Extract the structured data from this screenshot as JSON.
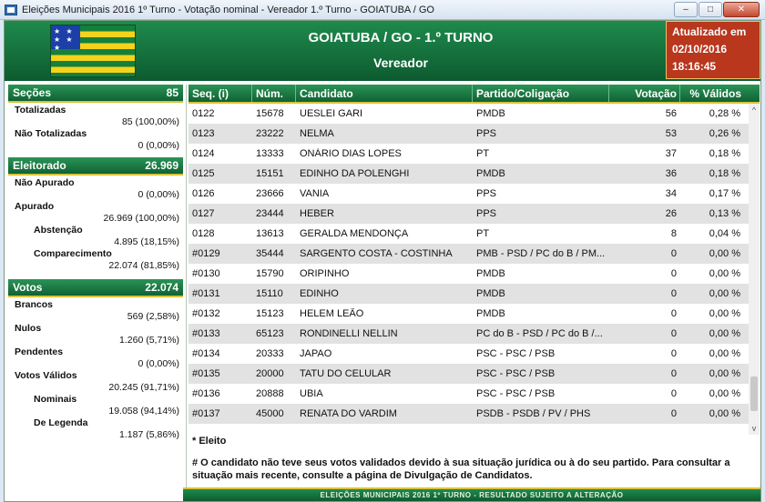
{
  "window": {
    "title": "Eleições Municipais 2016 1º Turno - Votação nominal - Vereador 1.º Turno - GOIATUBA / GO",
    "minimize": "–",
    "maximize": "□",
    "close": "✕"
  },
  "header": {
    "title": "GOIATUBA / GO - 1.º TURNO",
    "subtitle": "Vereador",
    "flag_stars": "★ ★ ★ ★ ★",
    "updated_label": "Atualizado em",
    "updated_date": "02/10/2016",
    "updated_time": "18:16:45"
  },
  "sidebar": {
    "secoes": {
      "label": "Seções",
      "value": "85"
    },
    "totalizadas": {
      "label": "Totalizadas",
      "value": "85 (100,00%)"
    },
    "nao_totalizadas": {
      "label": "Não Totalizadas",
      "value": "0 (0,00%)"
    },
    "eleitorado": {
      "label": "Eleitorado",
      "value": "26.969"
    },
    "nao_apurado": {
      "label": "Não Apurado",
      "value": "0 (0,00%)"
    },
    "apurado": {
      "label": "Apurado",
      "value": "26.969 (100,00%)"
    },
    "abstencao": {
      "label": "Abstenção",
      "value": "4.895 (18,15%)"
    },
    "comparecimento": {
      "label": "Comparecimento",
      "value": "22.074 (81,85%)"
    },
    "votos": {
      "label": "Votos",
      "value": "22.074"
    },
    "brancos": {
      "label": "Brancos",
      "value": "569 (2,58%)"
    },
    "nulos": {
      "label": "Nulos",
      "value": "1.260 (5,71%)"
    },
    "pendentes": {
      "label": "Pendentes",
      "value": "0 (0,00%)"
    },
    "votos_validos": {
      "label": "Votos Válidos",
      "value": "20.245 (91,71%)"
    },
    "nominais": {
      "label": "Nominais",
      "value": "19.058 (94,14%)"
    },
    "legenda": {
      "label": "De Legenda",
      "value": "1.187 (5,86%)"
    }
  },
  "table": {
    "headers": [
      "Seq.  (i)",
      "Núm.",
      "Candidato",
      "Partido/Coligação",
      "Votação",
      "% Válidos"
    ],
    "rows": [
      {
        "seq": "0122",
        "num": "15678",
        "cand": "UESLEI GARI",
        "party": "PMDB",
        "votes": "56",
        "pct": "0,28 %"
      },
      {
        "seq": "0123",
        "num": "23222",
        "cand": "NELMA",
        "party": "PPS",
        "votes": "53",
        "pct": "0,26 %"
      },
      {
        "seq": "0124",
        "num": "13333",
        "cand": "ONÁRIO DIAS LOPES",
        "party": "PT",
        "votes": "37",
        "pct": "0,18 %"
      },
      {
        "seq": "0125",
        "num": "15151",
        "cand": "EDINHO DA POLENGHI",
        "party": "PMDB",
        "votes": "36",
        "pct": "0,18 %"
      },
      {
        "seq": "0126",
        "num": "23666",
        "cand": "VANIA",
        "party": "PPS",
        "votes": "34",
        "pct": "0,17 %"
      },
      {
        "seq": "0127",
        "num": "23444",
        "cand": "HEBER",
        "party": "PPS",
        "votes": "26",
        "pct": "0,13 %"
      },
      {
        "seq": "0128",
        "num": "13613",
        "cand": "GERALDA MENDONÇA",
        "party": "PT",
        "votes": "8",
        "pct": "0,04 %"
      },
      {
        "seq": "#0129",
        "num": "35444",
        "cand": "SARGENTO COSTA - COSTINHA",
        "party": "PMB - PSD / PC do B / PM...",
        "votes": "0",
        "pct": "0,00 %"
      },
      {
        "seq": "#0130",
        "num": "15790",
        "cand": "ORIPINHO",
        "party": "PMDB",
        "votes": "0",
        "pct": "0,00 %"
      },
      {
        "seq": "#0131",
        "num": "15110",
        "cand": "EDINHO",
        "party": "PMDB",
        "votes": "0",
        "pct": "0,00 %"
      },
      {
        "seq": "#0132",
        "num": "15123",
        "cand": "HELEM LEÃO",
        "party": "PMDB",
        "votes": "0",
        "pct": "0,00 %"
      },
      {
        "seq": "#0133",
        "num": "65123",
        "cand": "RONDINELLI NELLIN",
        "party": "PC do B - PSD / PC do B /...",
        "votes": "0",
        "pct": "0,00 %"
      },
      {
        "seq": "#0134",
        "num": "20333",
        "cand": "JAPAO",
        "party": "PSC - PSC / PSB",
        "votes": "0",
        "pct": "0,00 %"
      },
      {
        "seq": "#0135",
        "num": "20000",
        "cand": "TATU DO CELULAR",
        "party": "PSC - PSC / PSB",
        "votes": "0",
        "pct": "0,00 %"
      },
      {
        "seq": "#0136",
        "num": "20888",
        "cand": "UBIA",
        "party": "PSC - PSC / PSB",
        "votes": "0",
        "pct": "0,00 %"
      },
      {
        "seq": "#0137",
        "num": "45000",
        "cand": "RENATA DO VARDIM",
        "party": "PSDB - PSDB / PV / PHS",
        "votes": "0",
        "pct": "0,00 %"
      }
    ],
    "scroll_up": "^",
    "scroll_down": "v"
  },
  "notes": {
    "eleito": "* Eleito",
    "hash": "# O candidato não teve seus votos validados devido à sua situação jurídica ou à do seu partido. Para consultar a situação mais recente, consulte a página de Divulgação de Candidatos."
  },
  "footer": {
    "text": "ELEIÇÕES MUNICIPAIS 2016 1º TURNO - RESULTADO SUJEITO A ALTERAÇÃO"
  }
}
